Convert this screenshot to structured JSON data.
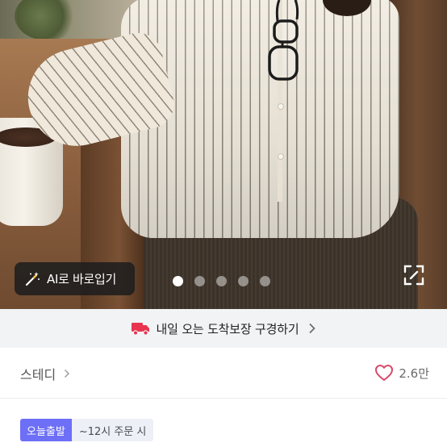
{
  "photo": {
    "ai_try_on_label": "AI로 바로입기",
    "carousel": {
      "total": 5,
      "active_index": 0
    }
  },
  "delivery_banner": {
    "text": "내일 오는 도착보장 구경하기"
  },
  "brand_row": {
    "brand_name": "스테디",
    "like_count": "2.6만"
  },
  "shipping_badges": {
    "primary": "오늘출발",
    "secondary": "~12시 주문 시"
  },
  "colors": {
    "badge_primary": "#6d6ff7",
    "banner_bg": "#f2f3f5",
    "truck_icon": "#e8344e",
    "heart_icon": "#d94a6b"
  },
  "icons": [
    "magic-wand-icon",
    "expand-icon",
    "truck-icon",
    "chevron-right-icon",
    "heart-icon"
  ]
}
